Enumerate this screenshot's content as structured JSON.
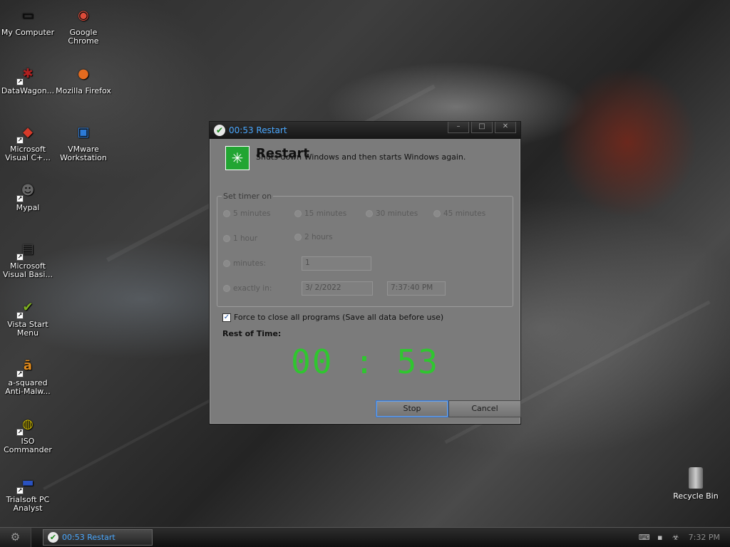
{
  "desktop": {
    "icons": [
      {
        "label": "My Computer",
        "glyph": "▭",
        "color": "#111111"
      },
      {
        "label": "Google Chrome",
        "glyph": "◉",
        "color": "#dd4b39"
      },
      {
        "label": "DataWagon...",
        "glyph": "✱",
        "color": "#b02020"
      },
      {
        "label": "Mozilla Firefox",
        "glyph": "●",
        "color": "#e56b1f"
      },
      {
        "label": "Microsoft Visual C+...",
        "glyph": "◆",
        "color": "#d63a2a"
      },
      {
        "label": "VMware Workstation",
        "glyph": "▣",
        "color": "#2c7ad6"
      },
      {
        "label": "Mypal",
        "glyph": "☻",
        "color": "#666666"
      },
      {
        "label": "Microsoft Visual Basi...",
        "glyph": "▤",
        "color": "#444444"
      },
      {
        "label": "Vista Start Menu",
        "glyph": "✔",
        "color": "#7fb020"
      },
      {
        "label": "a-squared Anti-Malw...",
        "glyph": "ā",
        "color": "#e08a1c"
      },
      {
        "label": "ISO Commander",
        "glyph": "◍",
        "color": "#c8b400"
      },
      {
        "label": "Trialsoft PC Analyst",
        "glyph": "▬",
        "color": "#2a52c0"
      }
    ],
    "recycle_bin": "Recycle Bin"
  },
  "dialog": {
    "title": "00:53 Restart",
    "heading": "Restart",
    "subtitle": "Shuts down Windows and then starts Windows again.",
    "group_label": "Set timer on",
    "options": {
      "min5": "5 minutes",
      "min15": "15 minutes",
      "min30": "30 minutes",
      "min45": "45 minutes",
      "hour1": "1 hour",
      "hour2": "2 hours",
      "minutes": "minutes:",
      "exactly": "exactly in:"
    },
    "minutes_value": "1",
    "date_value": "3/  2/2022",
    "time_value": "7:37:40 PM",
    "force_label": "Force to close all programs (Save all data before use)",
    "force_checked": true,
    "rest_label": "Rest of Time:",
    "countdown": "00 : 53",
    "stop_label": "Stop",
    "cancel_label": "Cancel",
    "countdown_color": "#2fc62f",
    "title_color": "#4aa8ff"
  },
  "taskbar": {
    "task_label": "00:53 Restart",
    "clock": "7:32 PM"
  }
}
